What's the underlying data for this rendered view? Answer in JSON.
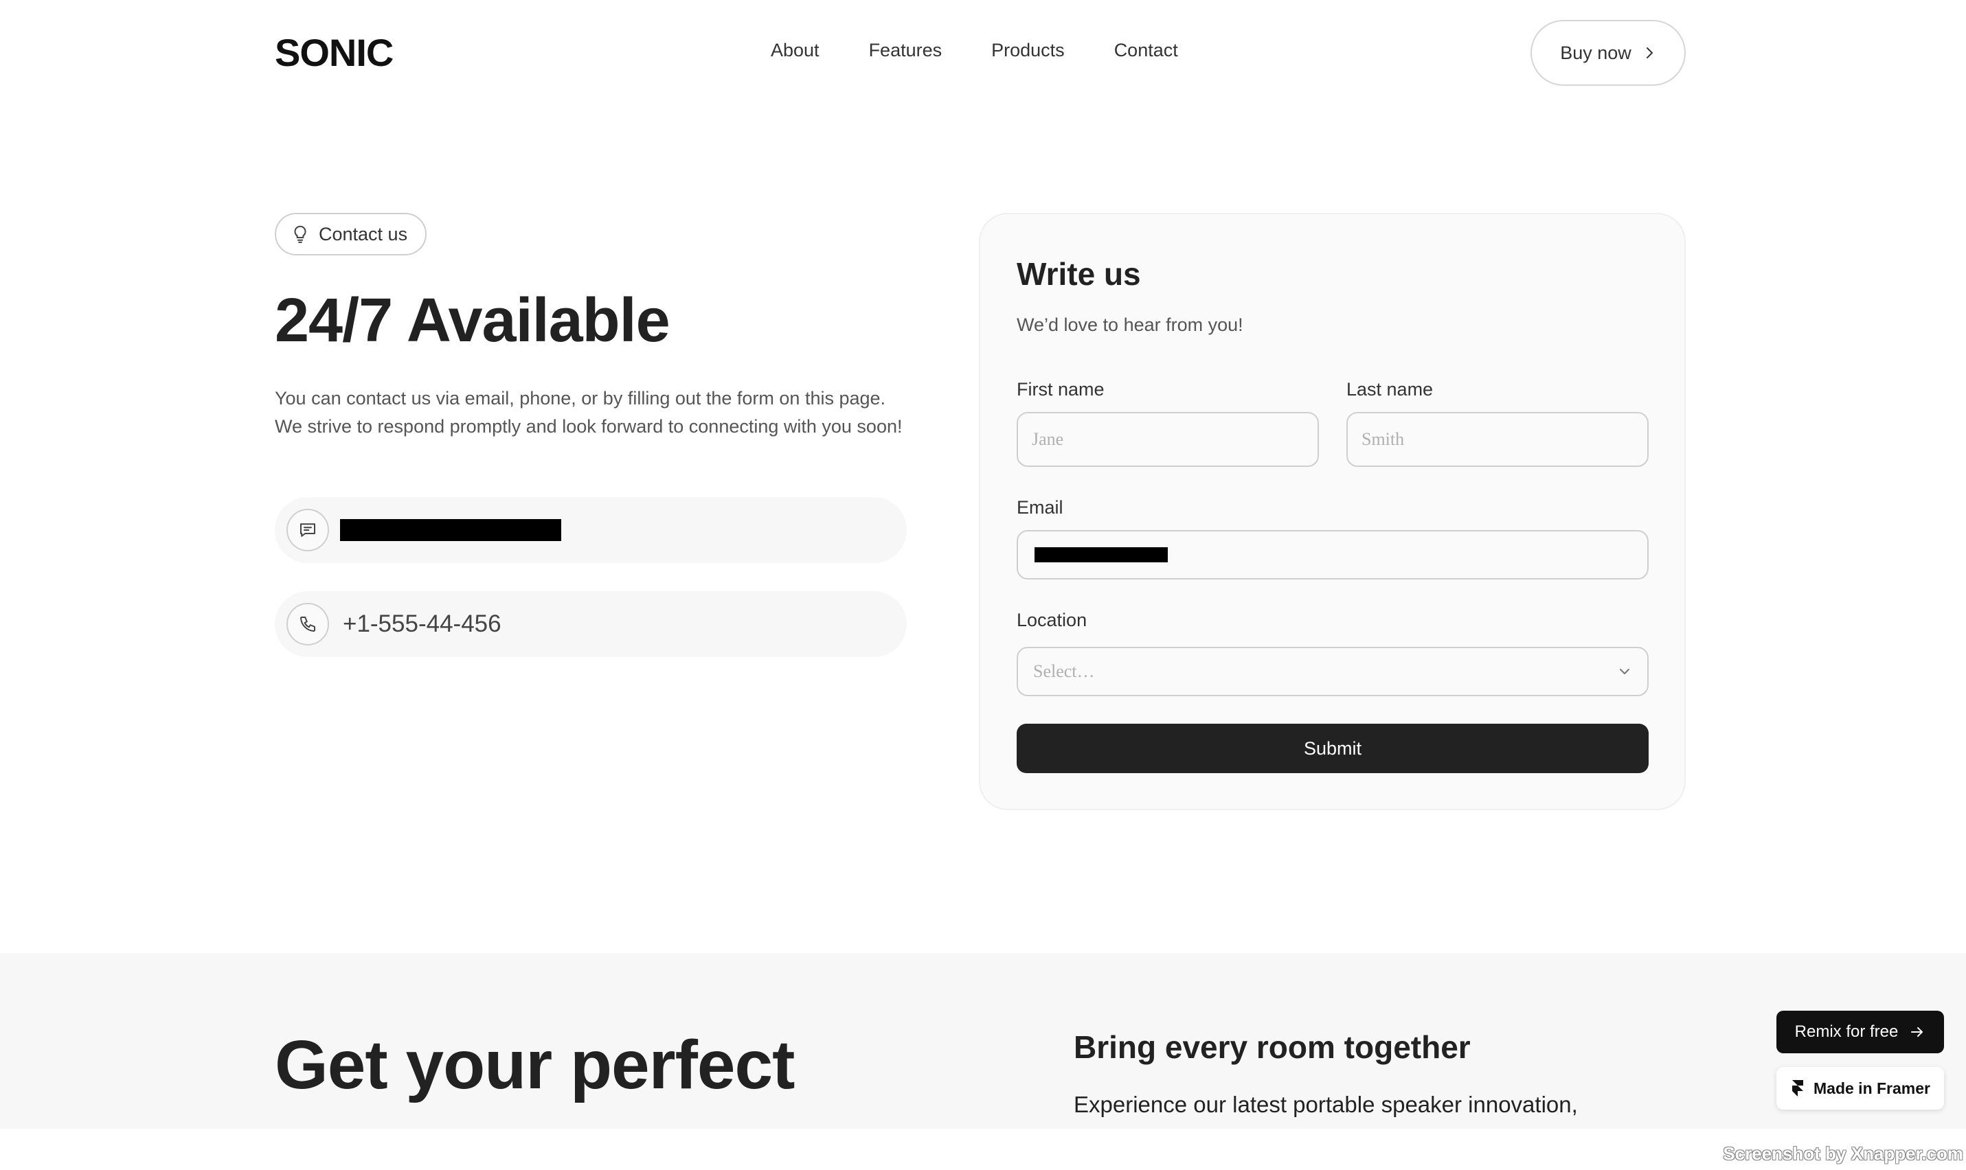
{
  "header": {
    "logo": "SONIC",
    "nav": [
      "About",
      "Features",
      "Products",
      "Contact"
    ],
    "buy_label": "Buy now"
  },
  "contact": {
    "pill_label": "Contact us",
    "title": "24/7 Available",
    "description": "You can contact us via email, phone, or by filling out the form on this page. We strive to respond promptly and look forward to connecting with you soon!",
    "phone": "+1-555-44-456"
  },
  "form": {
    "title": "Write us",
    "subtitle": "We’d love to hear from you!",
    "first_name_label": "First name",
    "first_name_placeholder": "Jane",
    "last_name_label": "Last name",
    "last_name_placeholder": "Smith",
    "email_label": "Email",
    "location_label": "Location",
    "location_placeholder": "Select…",
    "submit_label": "Submit"
  },
  "lower": {
    "title": "Get your perfect",
    "heading": "Bring every room together",
    "text": "Experience our latest portable speaker innovation,"
  },
  "badges": {
    "remix_label": "Remix for free",
    "made_label": "Made in Framer"
  },
  "watermark": "Screenshot by Xnapper.com",
  "colors": {
    "primary_button": "#222222",
    "card_background": "#fafafa",
    "section_background": "#f7f7f7"
  }
}
